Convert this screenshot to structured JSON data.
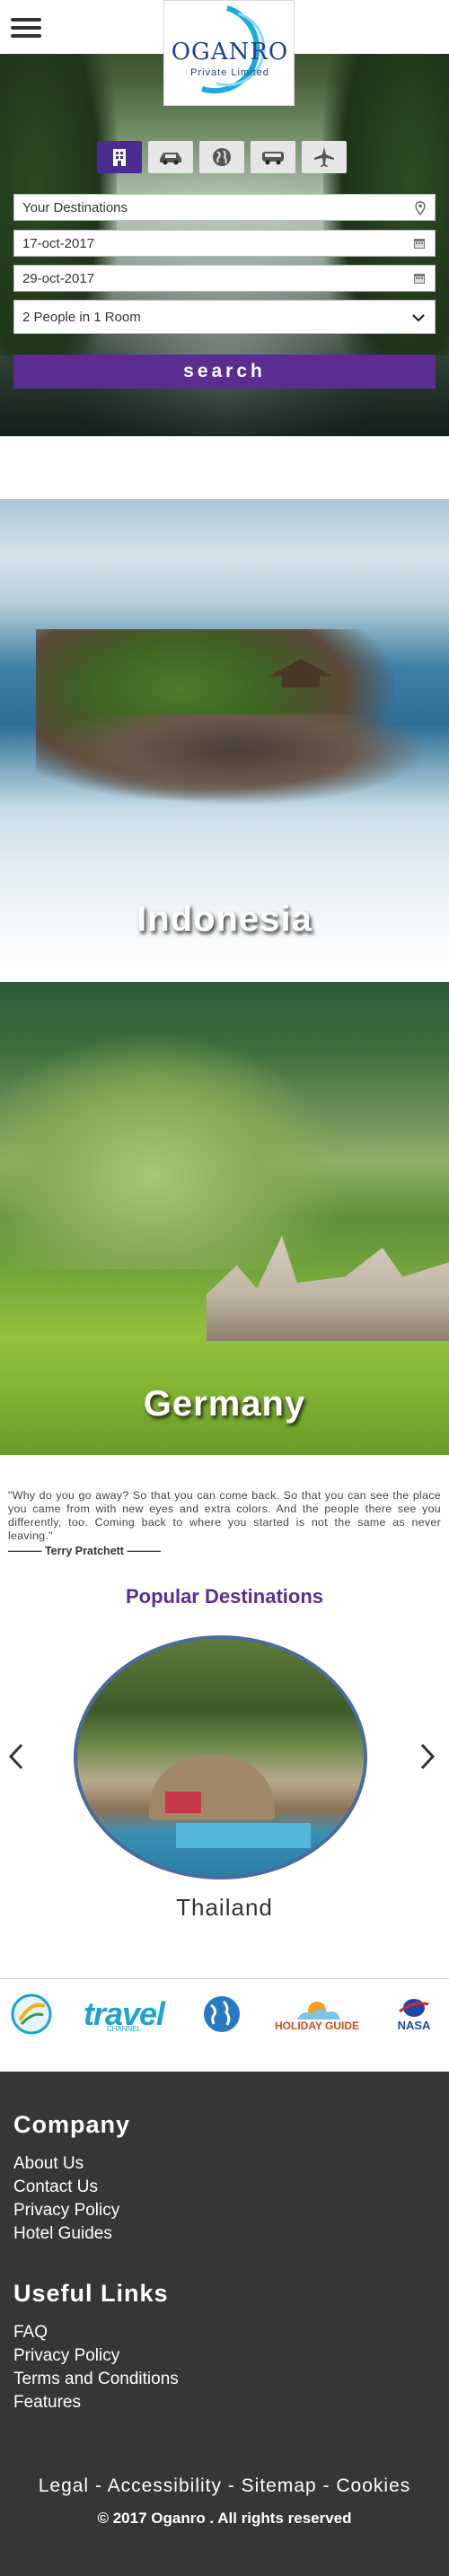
{
  "header": {
    "logo_name": "OGANRO",
    "logo_sub": "Private Limited"
  },
  "search": {
    "tabs": [
      {
        "icon": "hotel-icon",
        "active": true
      },
      {
        "icon": "car-icon",
        "active": false
      },
      {
        "icon": "globe-icon",
        "active": false
      },
      {
        "icon": "bus-icon",
        "active": false
      },
      {
        "icon": "airplane-icon",
        "active": false
      }
    ],
    "destination": "Your Destinations",
    "check_in": "17-oct-2017",
    "check_out": "29-oct-2017",
    "guests": "2 People in 1 Room",
    "button": "search"
  },
  "destinations": [
    {
      "name": "Indonesia"
    },
    {
      "name": "Germany"
    }
  ],
  "quote": {
    "text": "\"Why do you go away? So that you can come back. So that you can see the place you came from with new eyes and extra colors. And the people there see you differently, too. Coming back to where you started is not the same as never leaving.\"",
    "author": "——— Terry Pratchett ———"
  },
  "popular": {
    "heading": "Popular Destinations",
    "current": "Thailand"
  },
  "partners": {
    "travel": "travel",
    "travel_sub": "CHANNEL",
    "holiday": "HOLIDAY GUIDE",
    "nasa": "NASA"
  },
  "footer": {
    "company_heading": "Company",
    "company_links": [
      "About Us",
      "Contact Us",
      "Privacy Policy",
      "Hotel Guides"
    ],
    "useful_heading": "Useful Links",
    "useful_links": [
      "FAQ",
      "Privacy Policy",
      "Terms and Conditions",
      "Features"
    ],
    "bottom_links": [
      "Legal",
      "Accessibility",
      "Sitemap",
      "Cookies"
    ],
    "copyright": "© 2017 Oganro . All rights reserved"
  },
  "colors": {
    "accent": "#5b2d91",
    "footer_bg": "#373535"
  }
}
